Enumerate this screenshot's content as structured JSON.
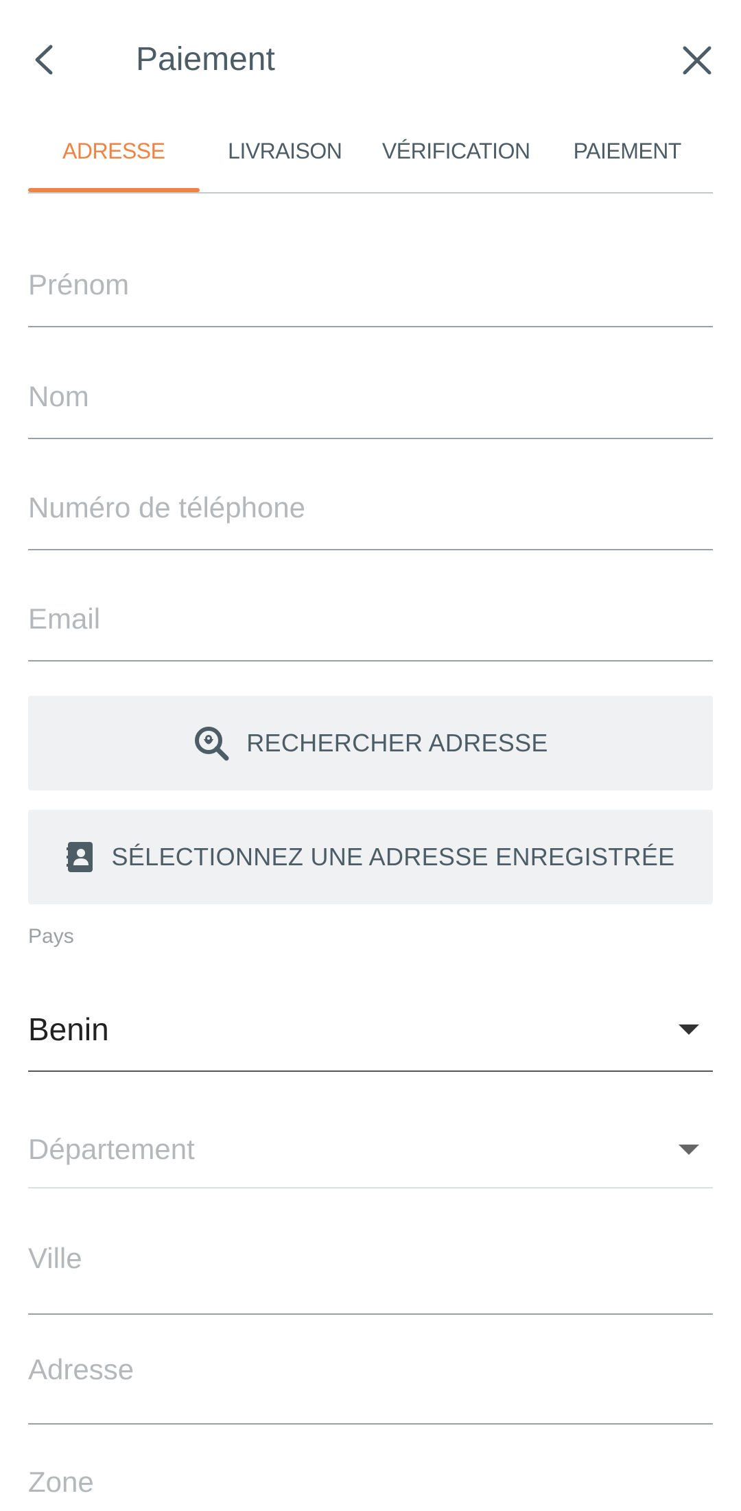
{
  "header": {
    "title": "Paiement"
  },
  "tabs": [
    {
      "label": "ADRESSE",
      "active": true
    },
    {
      "label": "LIVRAISON",
      "active": false
    },
    {
      "label": "VÉRIFICATION",
      "active": false
    },
    {
      "label": "PAIEMENT",
      "active": false
    }
  ],
  "form": {
    "first_name_placeholder": "Prénom",
    "last_name_placeholder": "Nom",
    "phone_placeholder": "Numéro de téléphone",
    "email_placeholder": "Email",
    "search_address_label": "RECHERCHER ADRESSE",
    "select_saved_address_label": "SÉLECTIONNEZ UNE ADRESSE ENREGISTRÉE",
    "country_label": "Pays",
    "country_value": "Benin",
    "department_placeholder": "Département",
    "city_placeholder": "Ville",
    "address_placeholder": "Adresse",
    "zone_placeholder": "Zone"
  },
  "colors": {
    "accent": "#ef8344",
    "text": "#4d5d66",
    "placeholder": "#b4b8bb",
    "button_bg": "#eff1f3"
  }
}
